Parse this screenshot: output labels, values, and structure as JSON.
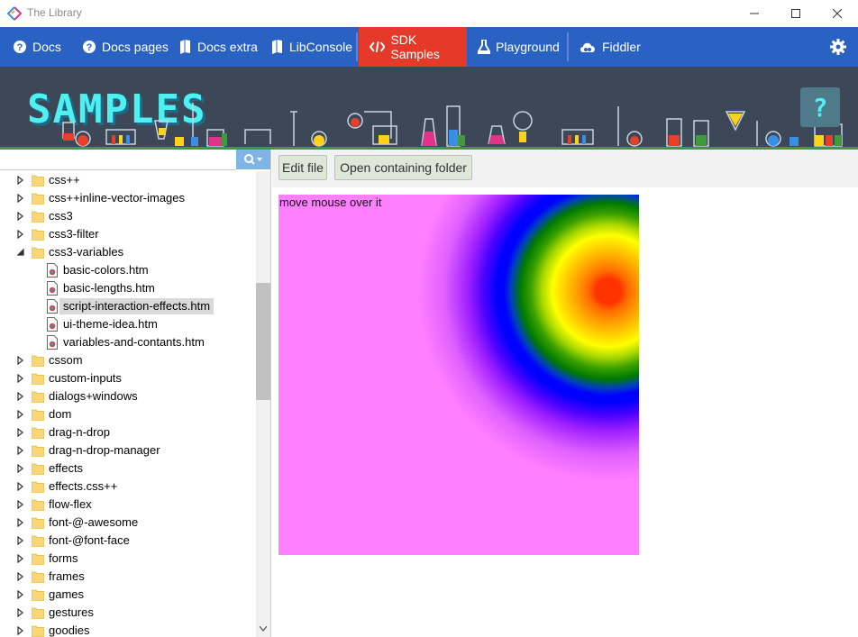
{
  "window": {
    "title": "The Library"
  },
  "nav": {
    "items": [
      {
        "label": "Docs",
        "icon": "help-circle-icon"
      },
      {
        "label": "Docs pages",
        "icon": "help-circle-icon"
      },
      {
        "label": "Docs extra",
        "icon": "book-icon"
      },
      {
        "label": "LibConsole",
        "icon": "book-icon"
      },
      {
        "label": "SDK Samples",
        "icon": "code-icon",
        "active": true
      },
      {
        "label": "Playground",
        "icon": "flask-icon"
      },
      {
        "label": "Fiddler",
        "icon": "cloud-icon"
      }
    ],
    "active_color": "#e53a2a",
    "bar_color": "#2a62c4"
  },
  "banner": {
    "title": "SAMPLES",
    "help_label": "?"
  },
  "sidebar": {
    "search": {
      "value": "",
      "placeholder": ""
    },
    "tree": [
      {
        "label": "css++",
        "type": "folder",
        "expanded": false
      },
      {
        "label": "css++inline-vector-images",
        "type": "folder",
        "expanded": false
      },
      {
        "label": "css3",
        "type": "folder",
        "expanded": false
      },
      {
        "label": "css3-filter",
        "type": "folder",
        "expanded": false
      },
      {
        "label": "css3-variables",
        "type": "folder",
        "expanded": true
      },
      {
        "label": "basic-colors.htm",
        "type": "file"
      },
      {
        "label": "basic-lengths.htm",
        "type": "file"
      },
      {
        "label": "script-interaction-effects.htm",
        "type": "file",
        "selected": true
      },
      {
        "label": "ui-theme-idea.htm",
        "type": "file"
      },
      {
        "label": "variables-and-contants.htm",
        "type": "file"
      },
      {
        "label": "cssom",
        "type": "folder",
        "expanded": false
      },
      {
        "label": "custom-inputs",
        "type": "folder",
        "expanded": false
      },
      {
        "label": "dialogs+windows",
        "type": "folder",
        "expanded": false
      },
      {
        "label": "dom",
        "type": "folder",
        "expanded": false
      },
      {
        "label": "drag-n-drop",
        "type": "folder",
        "expanded": false
      },
      {
        "label": "drag-n-drop-manager",
        "type": "folder",
        "expanded": false
      },
      {
        "label": "effects",
        "type": "folder",
        "expanded": false
      },
      {
        "label": "effects.css++",
        "type": "folder",
        "expanded": false
      },
      {
        "label": "flow-flex",
        "type": "folder",
        "expanded": false
      },
      {
        "label": "font-@-awesome",
        "type": "folder",
        "expanded": false
      },
      {
        "label": "font-@font-face",
        "type": "folder",
        "expanded": false
      },
      {
        "label": "forms",
        "type": "folder",
        "expanded": false
      },
      {
        "label": "frames",
        "type": "folder",
        "expanded": false
      },
      {
        "label": "games",
        "type": "folder",
        "expanded": false
      },
      {
        "label": "gestures",
        "type": "folder",
        "expanded": false
      },
      {
        "label": "goodies",
        "type": "folder",
        "expanded": false
      }
    ]
  },
  "toolbar": {
    "edit_label": "Edit file",
    "open_folder_label": "Open containing folder"
  },
  "demo": {
    "hint": "move mouse over it",
    "background_color": "#ff80ff"
  }
}
